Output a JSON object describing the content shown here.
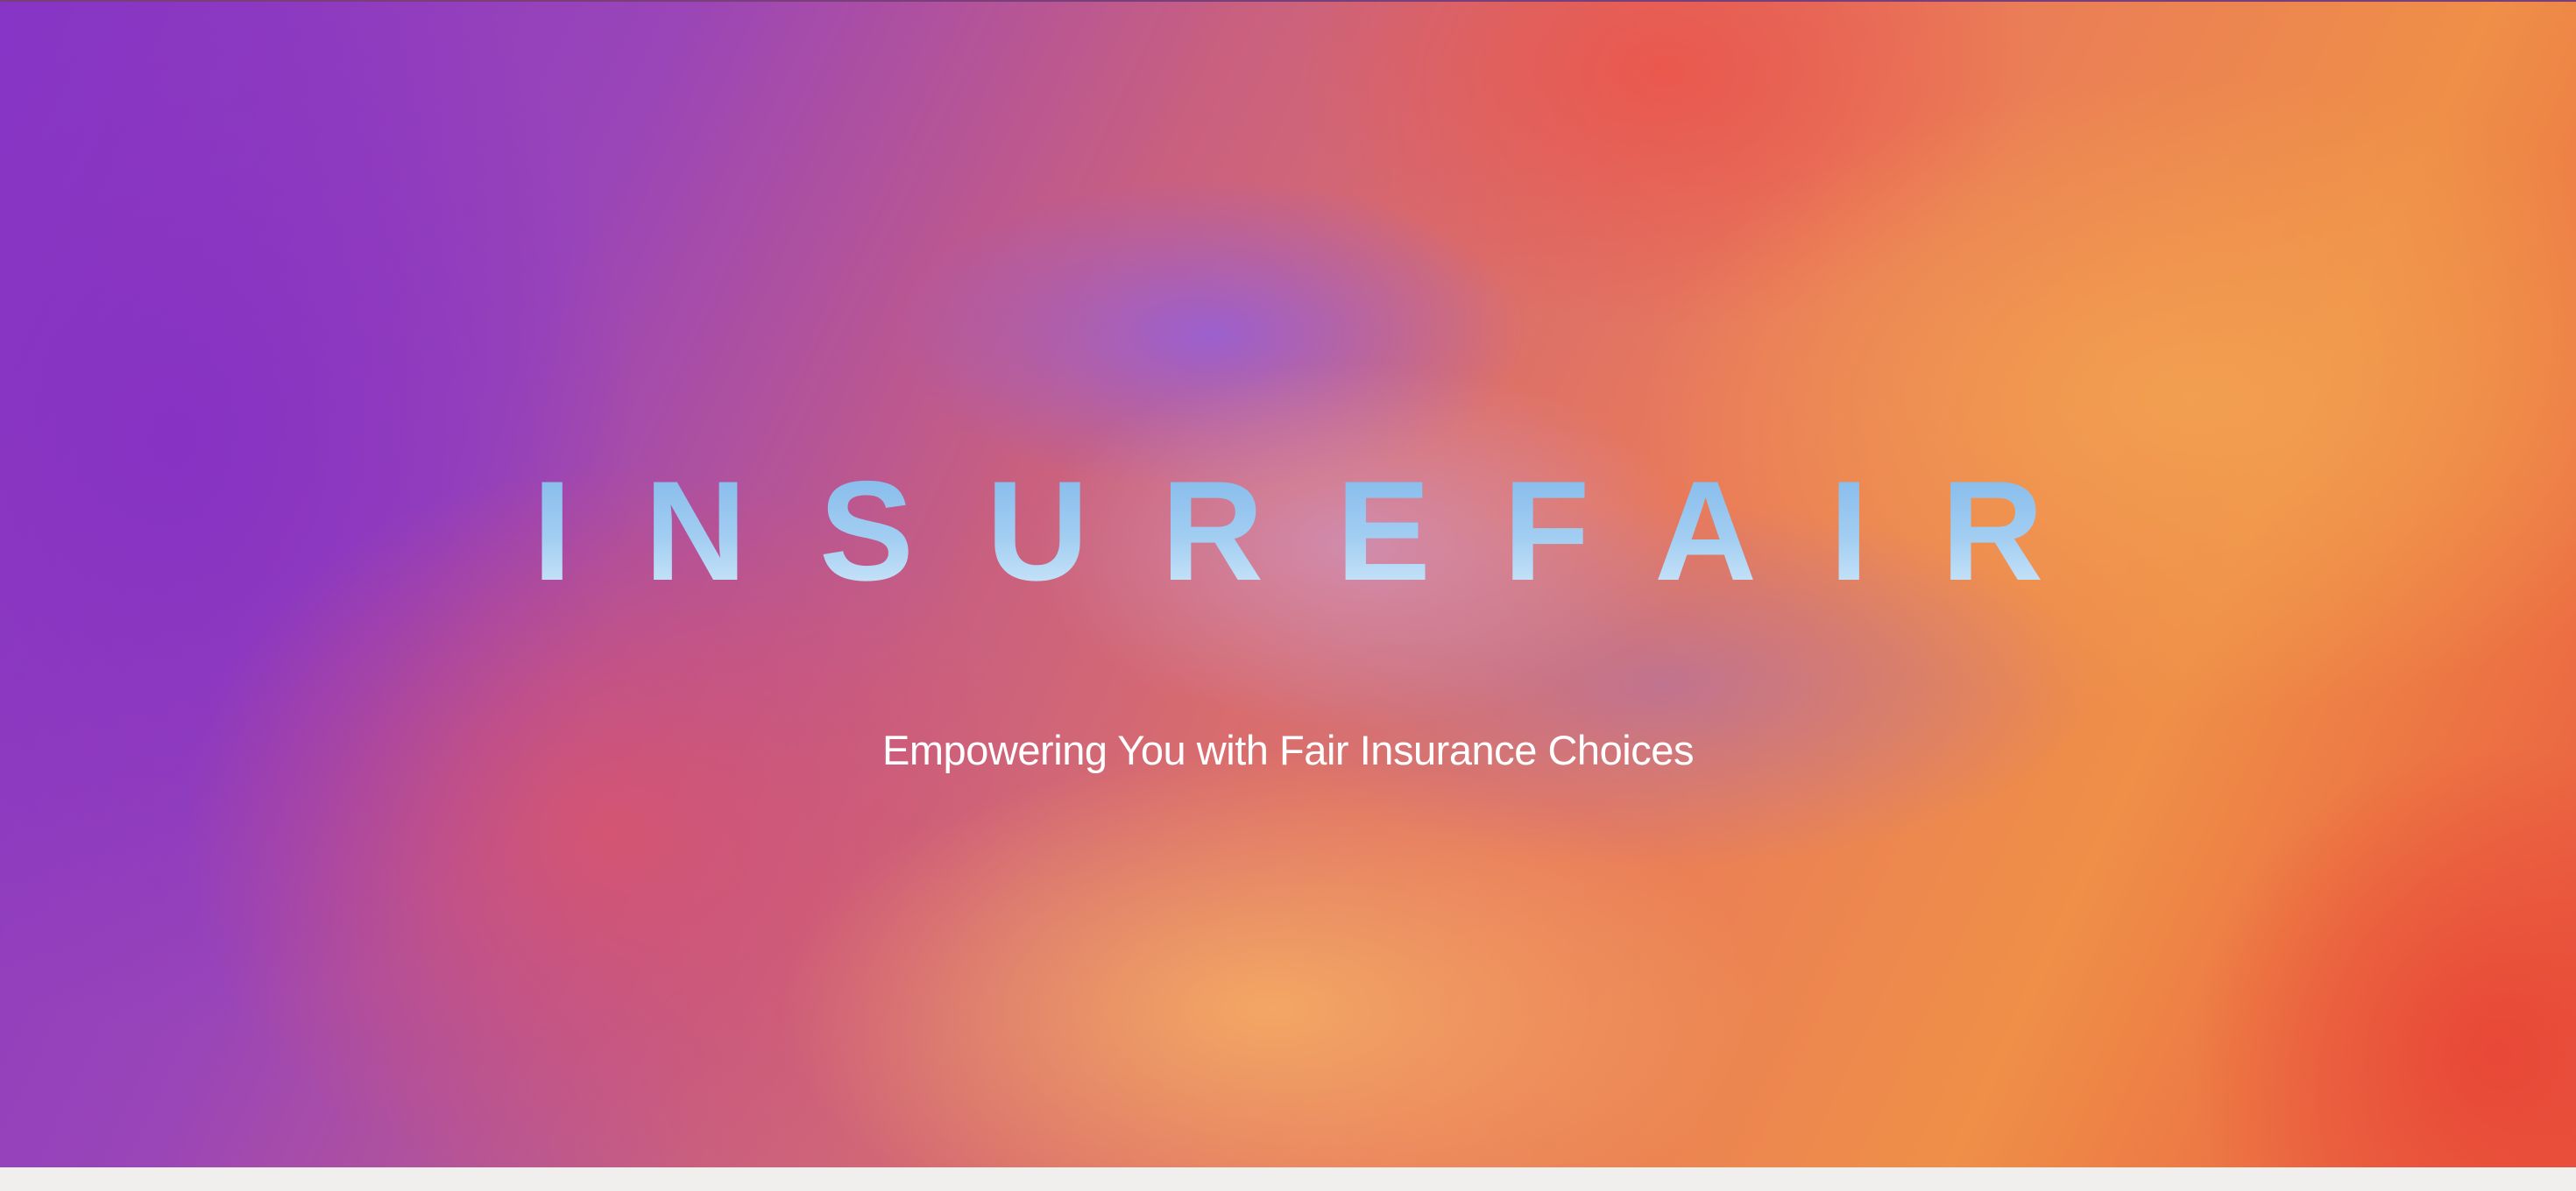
{
  "hero": {
    "brand_name": "INSUREFAIR",
    "tagline": "Empowering You with Fair Insurance Choices"
  },
  "colors": {
    "gradient_purple": "#8535c6",
    "gradient_orange": "#ef8f48",
    "gradient_red": "#e9573f",
    "brand_text_light_blue": "#a9d3f2",
    "tagline_text": "#ffffff",
    "page_background": "#f0efee"
  }
}
